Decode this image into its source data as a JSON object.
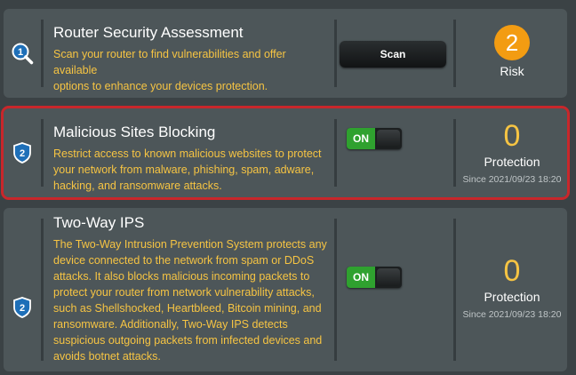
{
  "cards": [
    {
      "index": "1",
      "title": "Router Security Assessment",
      "desc_lines": [
        "Scan your router to find vulnerabilities and offer available",
        "options to enhance your devices protection."
      ],
      "button": "Scan",
      "status_value": "2",
      "status_label": "Risk"
    },
    {
      "index": "2",
      "title": "Malicious Sites Blocking",
      "desc_lines": [
        "Restrict access to known malicious websites to protect",
        "your network from malware, phishing, spam, adware,",
        "hacking, and ransomware attacks."
      ],
      "toggle": "ON",
      "status_value": "0",
      "status_label": "Protection",
      "since": "Since 2021/09/23 18:20"
    },
    {
      "index": "2",
      "title": "Two-Way IPS",
      "desc_lines": [
        "The Two-Way Intrusion Prevention System protects any",
        "device connected to the network from spam or DDoS",
        "attacks. It also blocks malicious incoming packets to",
        "protect your router from network vulnerability attacks,",
        "such as Shellshocked, Heartbleed, Bitcoin mining, and",
        "ransomware. Additionally, Two-Way IPS detects",
        "suspicious outgoing packets from infected devices and",
        "avoids botnet attacks."
      ],
      "toggle": "ON",
      "status_value": "0",
      "status_label": "Protection",
      "since": "Since 2021/09/23 18:20"
    }
  ],
  "colors": {
    "accent_text": "#f6c443",
    "risk": "#f39c12",
    "toggle_on": "#2fa12f",
    "highlight": "#c8272b"
  },
  "icons": [
    "magnifier-badge-icon",
    "shield-badge-icon"
  ]
}
